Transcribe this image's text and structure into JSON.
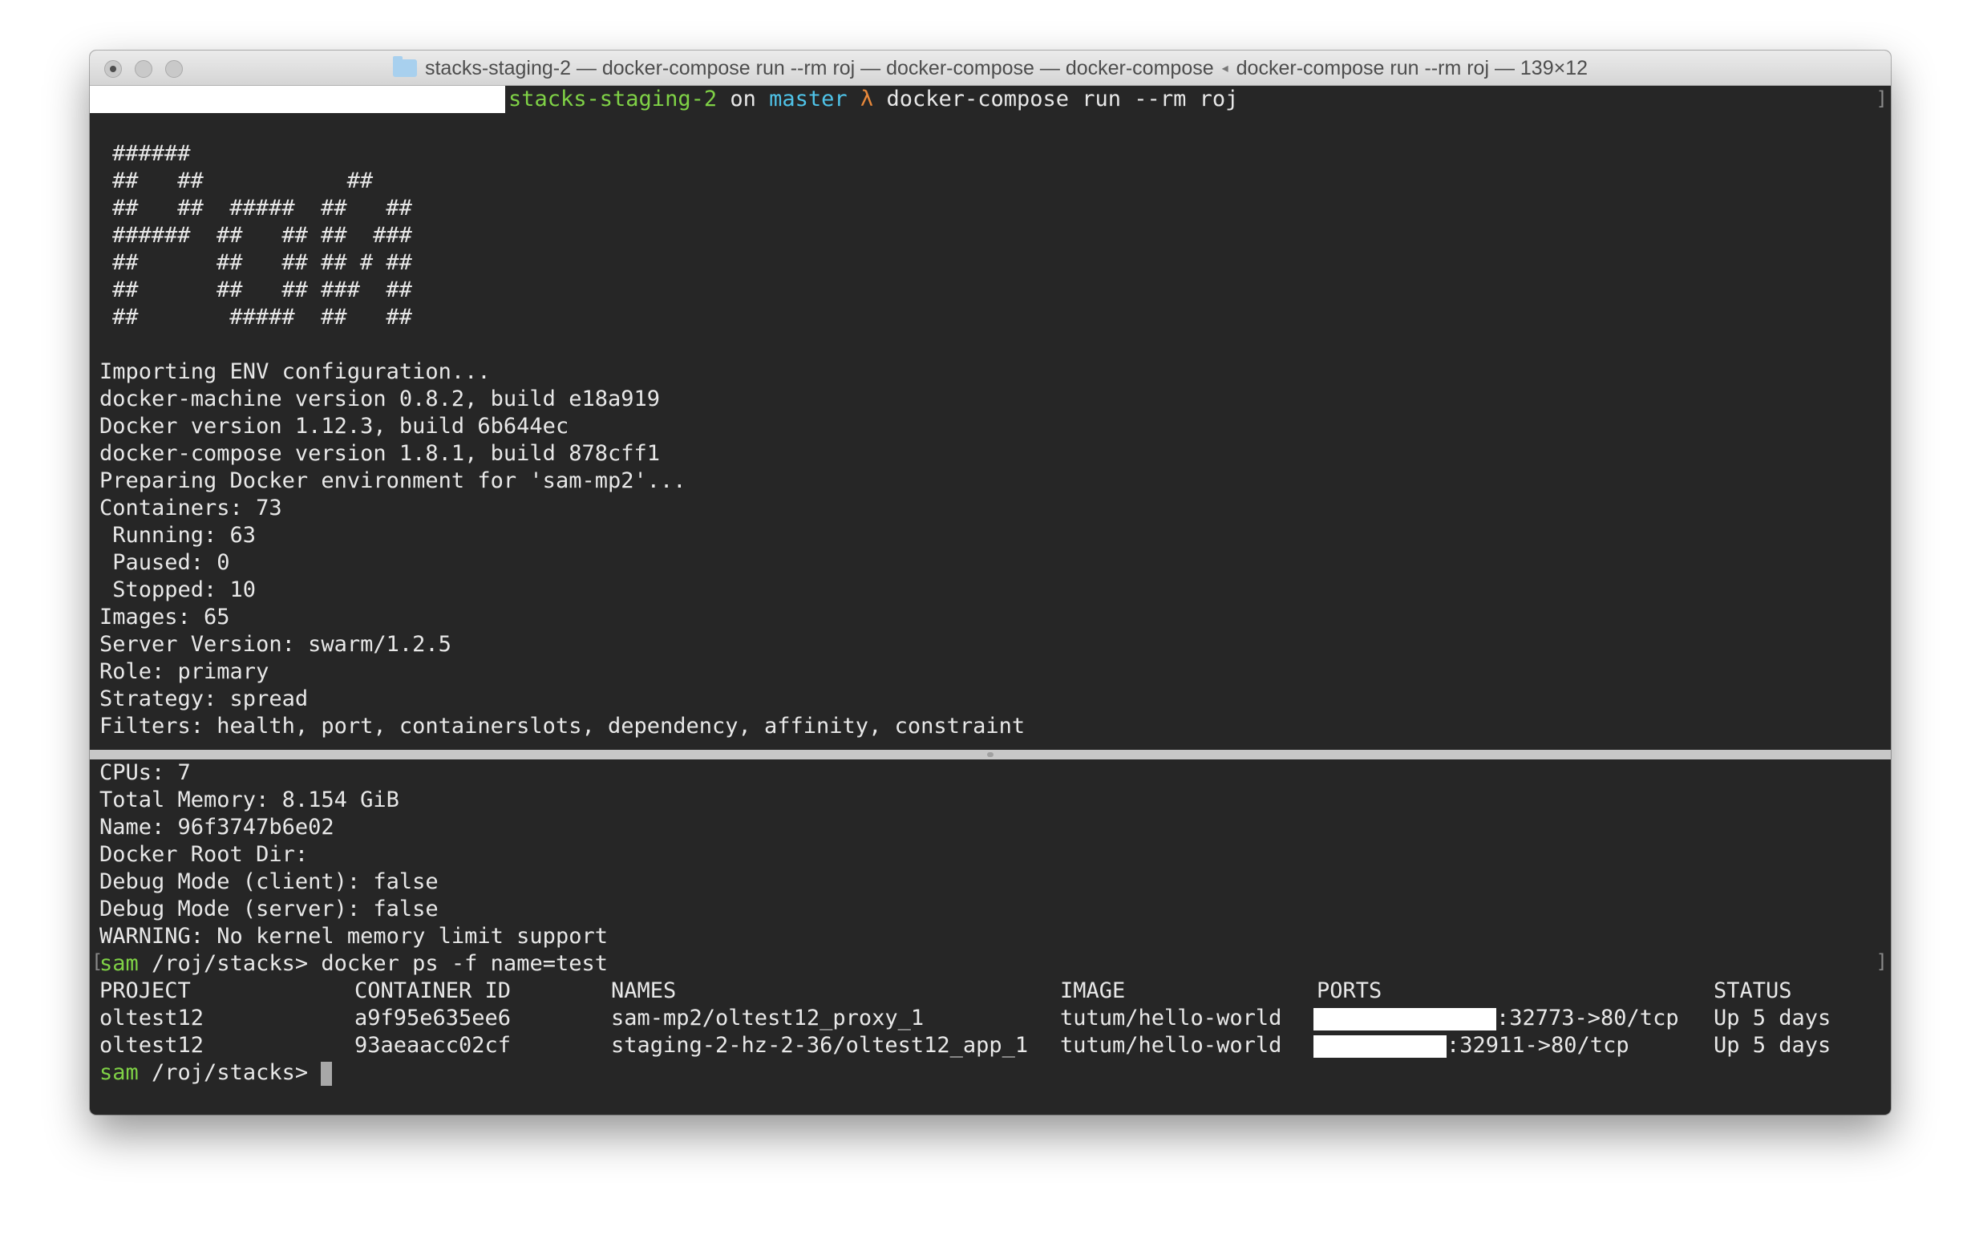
{
  "window": {
    "title_parts": [
      "stacks-staging-2 — docker-compose run --rm roj — docker-compose — docker-compose",
      "docker-compose run --rm roj — 139×12"
    ]
  },
  "prompt1": {
    "dir": "stacks-staging-2",
    "on": " on ",
    "branch": "master",
    "lambda": " λ ",
    "command": "docker-compose run --rm roj"
  },
  "banner": [
    "######",
    "##   ##           ##",
    "##   ##  #####  ##   ##",
    "######  ##   ## ##  ###",
    "##      ##   ## ## # ##",
    "##      ##   ## ###  ##",
    "##       #####  ##   ##"
  ],
  "output_top": [
    "Importing ENV configuration...",
    "docker-machine version 0.8.2, build e18a919",
    "Docker version 1.12.3, build 6b644ec",
    "docker-compose version 1.8.1, build 878cff1",
    "Preparing Docker environment for 'sam-mp2'...",
    "Containers: 73",
    " Running: 63",
    " Paused: 0",
    " Stopped: 10",
    "Images: 65",
    "Server Version: swarm/1.2.5",
    "Role: primary",
    "Strategy: spread",
    "Filters: health, port, containerslots, dependency, affinity, constraint"
  ],
  "output_bottom": [
    "CPUs: 7",
    "Total Memory: 8.154 GiB",
    "Name: 96f3747b6e02",
    "Docker Root Dir:",
    "Debug Mode (client): false",
    "Debug Mode (server): false",
    "WARNING: No kernel memory limit support"
  ],
  "prompt2": {
    "user": "sam",
    "path": " /roj/stacks> ",
    "command": "docker ps -f name=test"
  },
  "table": {
    "headers": [
      "PROJECT",
      "CONTAINER ID",
      "NAMES",
      "IMAGE",
      "PORTS",
      "STATUS"
    ],
    "rows": [
      [
        "oltest12",
        "a9f95e635ee6",
        "sam-mp2/oltest12_proxy_1",
        "tutum/hello-world",
        ":32773->80/tcp",
        "Up 5 days"
      ],
      [
        "oltest12",
        "93aeaacc02cf",
        "staging-2-hz-2-36/oltest12_app_1",
        "tutum/hello-world",
        ":32911->80/tcp",
        "Up 5 days"
      ]
    ]
  },
  "prompt3": {
    "user": "sam",
    "path": " /roj/stacks>"
  }
}
